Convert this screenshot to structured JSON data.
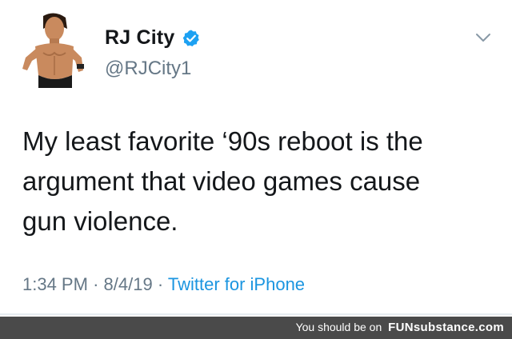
{
  "tweet": {
    "author": {
      "display_name": "RJ City",
      "handle": "@RJCity1",
      "verified": true,
      "avatar": "avatar-shirtless-man-pointing"
    },
    "text_lines": [
      "My least favorite ‘90s reboot is the",
      "argument that video games cause",
      "gun violence."
    ],
    "time": "1:34 PM",
    "date": "8/4/19",
    "separator": "·",
    "source": "Twitter for iPhone",
    "menu_icon": "chevron-down-icon"
  },
  "footer": {
    "prefix": "You should be on",
    "brand": "FUNsubstance.com",
    "background": "#4a4a4a"
  },
  "colors": {
    "text": "#14171a",
    "secondary": "#657786",
    "link": "#1b95e0",
    "verified": "#1da1f2"
  }
}
